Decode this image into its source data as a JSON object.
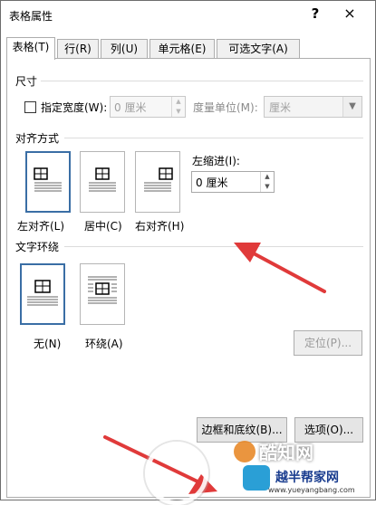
{
  "dialog": {
    "title": "表格属性",
    "help_glyph": "?",
    "close_glyph": "×"
  },
  "tabs": [
    {
      "label": "表格(T)",
      "active": true
    },
    {
      "label": "行(R)",
      "active": false
    },
    {
      "label": "列(U)",
      "active": false
    },
    {
      "label": "单元格(E)",
      "active": false
    },
    {
      "label": "可选文字(A)",
      "active": false
    }
  ],
  "size": {
    "heading": "尺寸",
    "preferred_width_label": "指定宽度(W):",
    "preferred_width_checked": false,
    "width_value": "0 厘米",
    "measure_label": "度量单位(M):",
    "measure_value": "厘米"
  },
  "alignment": {
    "heading": "对齐方式",
    "options": [
      {
        "label": "左对齐(L)",
        "selected": true
      },
      {
        "label": "居中(C)",
        "selected": false
      },
      {
        "label": "右对齐(H)",
        "selected": false
      }
    ],
    "indent_label": "左缩进(I):",
    "indent_value": "0 厘米"
  },
  "text_wrapping": {
    "heading": "文字环绕",
    "options": [
      {
        "label": "无(N)",
        "selected": true
      },
      {
        "label": "环绕(A)",
        "selected": false
      }
    ],
    "position_button": "定位(P)..."
  },
  "footer": {
    "borders_button": "边框和底纹(B)...",
    "options_button": "选项(O)..."
  },
  "watermark": {
    "logo_text": "酷知网",
    "site_text": "www.yueyangbang.com",
    "brand_text": "越半帮家网"
  },
  "colors": {
    "selection_border": "#3a6ea5",
    "arrow": "#e03a3a"
  }
}
